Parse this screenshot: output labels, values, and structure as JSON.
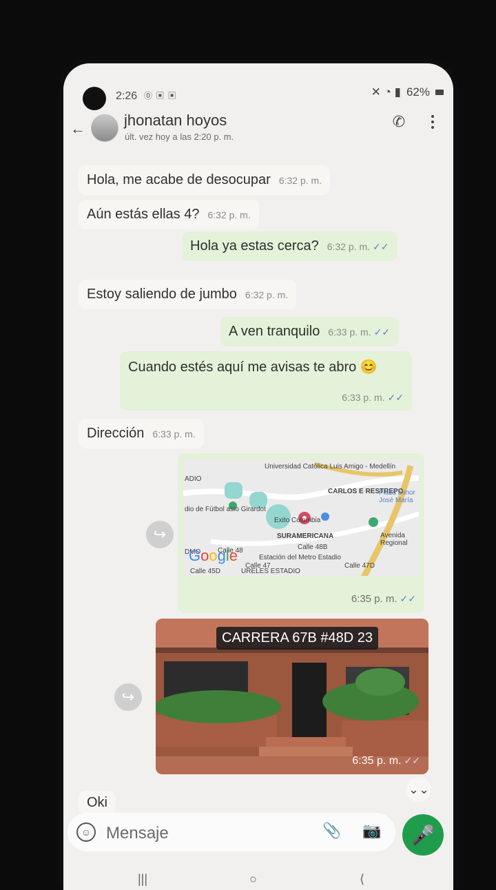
{
  "status": {
    "time": "2:26",
    "left_icons": "⓪ ▣ ▣",
    "right_icons": "✕ ◔ ▮",
    "battery": "62%"
  },
  "header": {
    "back_icon": "←",
    "name": "jhonatan hoyos",
    "last_seen": "últ. vez hoy a las 2:20 p. m.",
    "call_icon": "✆",
    "menu_icon": "⋮"
  },
  "messages": [
    {
      "text": "Hola, me acabe de desocupar",
      "time": "6:32 p. m.",
      "direction": "in"
    },
    {
      "text": "Aún estás ellas 4?",
      "time": "6:32 p. m.",
      "direction": "in"
    },
    {
      "text": "Hola ya estas cerca?",
      "time": "6:32 p. m.",
      "direction": "out"
    },
    {
      "text": "Estoy saliendo de jumbo",
      "time": "6:32 p. m.",
      "direction": "in"
    },
    {
      "text": "A ven tranquilo",
      "time": "6:33 p. m.",
      "direction": "out"
    },
    {
      "text": "Cuando estés aquí me avisas te abro 😊",
      "time": "6:33 p. m.",
      "direction": "out"
    },
    {
      "text": "Dirección",
      "time": "6:33 p. m.",
      "direction": "in"
    }
  ],
  "map": {
    "labels": [
      "Universidad Católica Luis Amigo - Medellín",
      "ADIO",
      "dio de Fútbol asio Girardot",
      "Exito Colombia",
      "SURAMERICANA",
      "CARLOS E RESTREPO",
      "Plaza Minor José María",
      "Estación del Metro Estadio",
      "Calle 48",
      "Calle 47",
      "Calle 45D",
      "Avenida Regional",
      "Calle 48B",
      "Calle 47D",
      "URELES ESTADIO",
      "DMO"
    ],
    "brand": "Google",
    "time": "6:35 p. m."
  },
  "photo": {
    "address": "CARRERA 67B #48D 23",
    "time": "6:35 p. m."
  },
  "partial_message": "Oki",
  "input": {
    "placeholder": "Mensaje",
    "emoji_icon": "☺",
    "attach_icon": "📎",
    "camera_icon": "📷",
    "mic_icon": "🎤"
  },
  "navigation": {
    "recent_icon": "|||",
    "home_icon": "○",
    "back_icon": "⟨"
  },
  "colors": {
    "out_bubble": "#e3f2d8",
    "in_bubble": "#f7f6f3",
    "mic": "#1f9d4c",
    "check": "#5c82c7"
  }
}
